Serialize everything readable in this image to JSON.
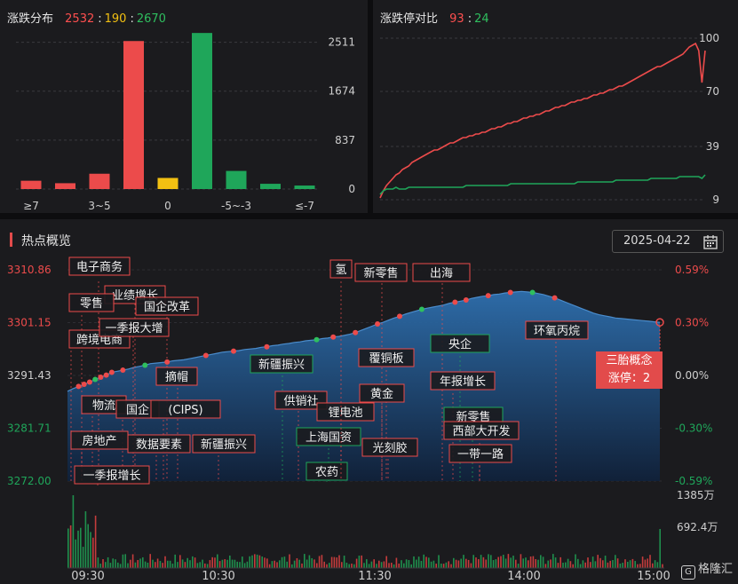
{
  "panel1": {
    "title": "涨跌分布",
    "up": "2532",
    "flat": "190",
    "down": "2670"
  },
  "panel2": {
    "title": "涨跌停对比",
    "limit_up": "93",
    "limit_down": "24"
  },
  "hot": {
    "title": "热点概览",
    "date": "2025-04-22",
    "tooltip_line1": "三胎概念",
    "tooltip_line2": "涨停：2"
  },
  "watermark": "格隆汇",
  "colors": {
    "up": "#ec4b4b",
    "flat": "#f2c012",
    "down": "#1fa65a",
    "panel": "#1b1b1e"
  },
  "chart_data": [
    {
      "type": "bar",
      "title": "涨跌分布",
      "categories": [
        "≥7",
        "",
        "3~5",
        "",
        "0",
        "",
        "-5~-3",
        "",
        "≤-7"
      ],
      "values": [
        142,
        100,
        262,
        2532,
        190,
        2670,
        310,
        90,
        60
      ],
      "bar_colors": [
        "up",
        "up",
        "up",
        "up",
        "flat",
        "down",
        "down",
        "down",
        "down"
      ],
      "yticks": [
        "2511",
        "1674",
        "837",
        "0"
      ],
      "ylim": [
        0,
        2900
      ]
    },
    {
      "type": "line",
      "title": "涨跌停对比",
      "yticks": [
        "100",
        "70",
        "39",
        "9"
      ],
      "ylim": [
        9,
        100
      ],
      "series": [
        {
          "color": "up",
          "values": [
            10,
            14,
            17,
            19,
            21,
            23,
            24,
            26,
            27,
            28,
            30,
            31,
            32,
            33,
            34,
            35,
            36,
            37,
            37,
            38,
            39,
            40,
            41,
            41,
            42,
            43,
            44,
            44,
            45,
            45,
            46,
            46,
            47,
            47,
            48,
            49,
            49,
            50,
            50,
            51,
            52,
            52,
            53,
            53,
            54,
            55,
            55,
            56,
            56,
            57,
            57,
            58,
            59,
            59,
            60,
            61,
            61,
            62,
            62,
            63,
            64,
            64,
            65,
            65,
            66,
            66,
            67,
            68,
            68,
            69,
            69,
            70,
            71,
            71,
            72,
            73,
            73,
            74,
            75,
            76,
            77,
            78,
            79,
            80,
            81,
            82,
            83,
            84,
            84,
            85,
            86,
            87,
            88,
            89,
            90,
            91,
            93,
            95,
            96,
            97,
            93,
            75,
            93
          ]
        },
        {
          "color": "down",
          "values": [
            12,
            14,
            15,
            15,
            15,
            16,
            15,
            15,
            15,
            16,
            16,
            16,
            16,
            16,
            16,
            16,
            16,
            16,
            16,
            16,
            16,
            16,
            16,
            16,
            16,
            16,
            16,
            17,
            17,
            17,
            17,
            17,
            17,
            17,
            17,
            17,
            17,
            17,
            17,
            17,
            17,
            18,
            18,
            18,
            18,
            18,
            18,
            18,
            18,
            18,
            18,
            18,
            18,
            18,
            18,
            18,
            18,
            18,
            18,
            18,
            18,
            18,
            19,
            19,
            19,
            19,
            19,
            19,
            19,
            19,
            19,
            19,
            19,
            19,
            20,
            20,
            20,
            20,
            20,
            20,
            20,
            20,
            20,
            20,
            20,
            21,
            21,
            21,
            21,
            21,
            21,
            21,
            21,
            21,
            22,
            22,
            22,
            22,
            22,
            22,
            22,
            21,
            23
          ]
        }
      ]
    },
    {
      "type": "area",
      "title": "热点概览",
      "x_ticks": [
        "09:30",
        "10:30",
        "11:30",
        "14:00",
        "15:00"
      ],
      "y_left": [
        "3310.86",
        "3301.15",
        "3291.43",
        "3281.71",
        "3272.00"
      ],
      "y_right": [
        "0.59%",
        "0.30%",
        "0.00%",
        "-0.30%",
        "-0.59%"
      ],
      "volume_ticks": [
        "1385万",
        "692.4万"
      ],
      "ylim": [
        3272.0,
        3310.86
      ],
      "values": [
        3288.5,
        3289.0,
        3289.4,
        3289.8,
        3290.2,
        3290.7,
        3291.1,
        3291.5,
        3292.0,
        3292.2,
        3292.4,
        3292.6,
        3292.9,
        3293.1,
        3293.3,
        3293.6,
        3293.7,
        3293.8,
        3293.9,
        3294.1,
        3294.2,
        3294.3,
        3294.5,
        3294.7,
        3294.9,
        3295.1,
        3295.3,
        3295.5,
        3295.7,
        3295.8,
        3295.9,
        3296.0,
        3296.2,
        3296.3,
        3296.4,
        3296.6,
        3296.7,
        3296.9,
        3297.0,
        3297.2,
        3297.3,
        3297.5,
        3297.6,
        3297.8,
        3297.9,
        3298.0,
        3298.2,
        3298.3,
        3298.5,
        3298.6,
        3298.8,
        3299.0,
        3299.3,
        3299.7,
        3300.1,
        3300.5,
        3300.9,
        3301.2,
        3301.6,
        3302.0,
        3302.3,
        3302.7,
        3303.0,
        3303.3,
        3303.6,
        3303.8,
        3304.0,
        3304.2,
        3304.4,
        3304.7,
        3304.9,
        3305.1,
        3305.3,
        3305.6,
        3305.8,
        3306.0,
        3306.1,
        3306.3,
        3306.4,
        3306.6,
        3306.7,
        3306.8,
        3306.9,
        3306.8,
        3306.7,
        3306.5,
        3306.3,
        3306.0,
        3305.7,
        3305.3,
        3304.9,
        3304.5,
        3304.1,
        3303.7,
        3303.3,
        3302.9,
        3302.6,
        3302.4,
        3302.2,
        3302.0,
        3301.9,
        3301.8,
        3301.7,
        3301.6,
        3301.5,
        3301.4,
        3301.3,
        3301.2
      ],
      "labels": [
        {
          "text": "电子商务",
          "color": "up"
        },
        {
          "text": "业绩增长",
          "color": "up"
        },
        {
          "text": "国企改革",
          "color": "up"
        },
        {
          "text": "零售",
          "color": "up"
        },
        {
          "text": "跨境电商",
          "color": "up"
        },
        {
          "text": "一季报大增",
          "color": "up"
        },
        {
          "text": "摘帽",
          "color": "up"
        },
        {
          "text": "物流",
          "color": "up"
        },
        {
          "text": "国企",
          "color": "up"
        },
        {
          "text": "(CIPS)",
          "color": "up"
        },
        {
          "text": "房地产",
          "color": "up"
        },
        {
          "text": "数据要素",
          "color": "up"
        },
        {
          "text": "新疆振兴",
          "color": "up"
        },
        {
          "text": "一季报增长",
          "color": "up"
        },
        {
          "text": "新疆振兴",
          "color": "down"
        },
        {
          "text": "供销社",
          "color": "up"
        },
        {
          "text": "锂电池",
          "color": "up"
        },
        {
          "text": "上海国资",
          "color": "down"
        },
        {
          "text": "农药",
          "color": "down"
        },
        {
          "text": "氢",
          "color": "up"
        },
        {
          "text": "新零售",
          "color": "up"
        },
        {
          "text": "出海",
          "color": "up"
        },
        {
          "text": "覆铜板",
          "color": "up"
        },
        {
          "text": "黄金",
          "color": "up"
        },
        {
          "text": "光刻胶",
          "color": "up"
        },
        {
          "text": "央企",
          "color": "down"
        },
        {
          "text": "年报增长",
          "color": "up"
        },
        {
          "text": "新零售",
          "color": "down"
        },
        {
          "text": "西部大开发",
          "color": "up"
        },
        {
          "text": "一带一路",
          "color": "up"
        },
        {
          "text": "环氧丙烷",
          "color": "up"
        }
      ]
    }
  ]
}
